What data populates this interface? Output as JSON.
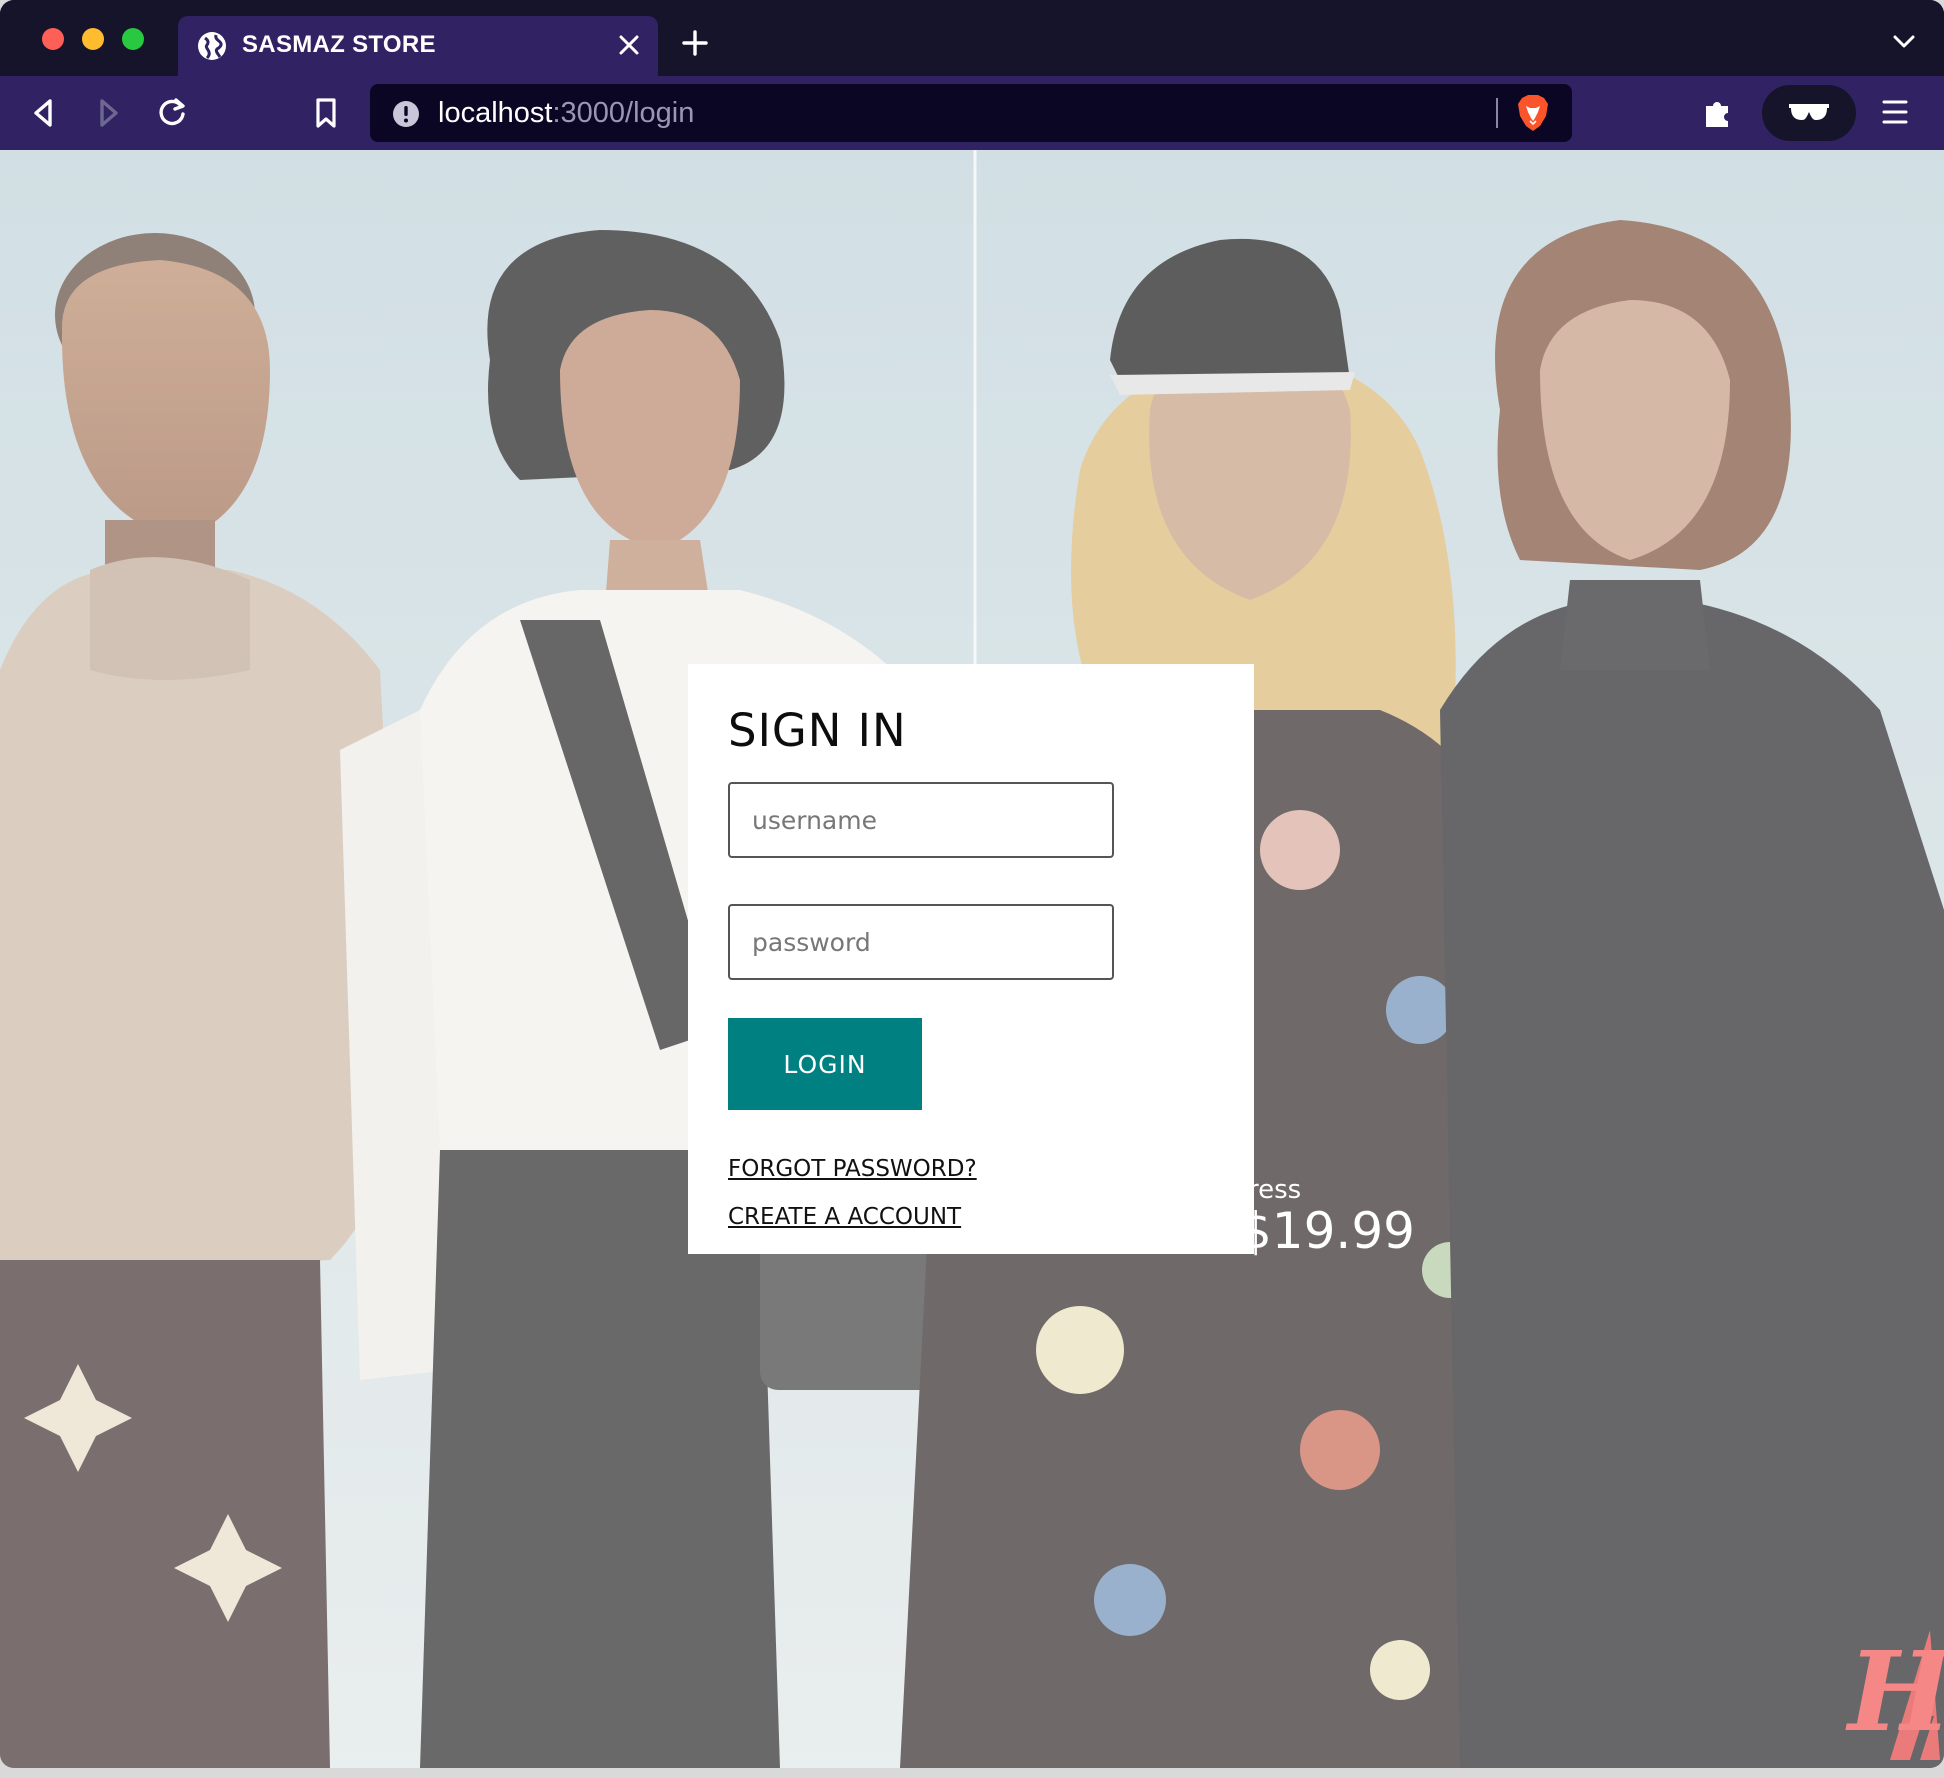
{
  "browser": {
    "tab_title": "SASMAZ STORE",
    "url_host": "localhost",
    "url_path": ":3000/login"
  },
  "hero": {
    "price_caption": "ress",
    "price": "$19.99",
    "brand_mark": "H"
  },
  "login": {
    "title": "SIGN IN",
    "username_placeholder": "username",
    "password_placeholder": "password",
    "login_label": "LOGIN",
    "forgot_label": "FORGOT PASSWORD?",
    "create_label": "CREATE A ACCOUNT"
  },
  "colors": {
    "tabstrip": "#15142b",
    "toolbar": "#312263",
    "url_field": "#0a0624",
    "login_button": "#008080"
  },
  "icons": [
    "globe-icon",
    "close-icon",
    "plus-icon",
    "chevron-down-icon",
    "back-icon",
    "forward-icon",
    "reload-icon",
    "bookmark-icon",
    "info-icon",
    "brave-lion-icon",
    "puzzle-icon",
    "glasses-icon",
    "menu-icon"
  ]
}
